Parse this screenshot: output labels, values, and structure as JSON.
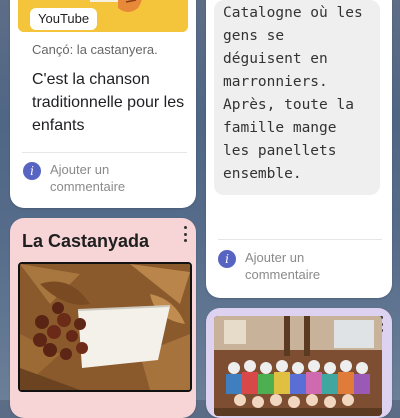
{
  "card1": {
    "thumbnail_badge": "YouTube",
    "caption": "Cançó: la castanyera.",
    "description": "C'est la chanson traditionnelle pour les enfants",
    "comment_label": "Ajouter un commentaire"
  },
  "card2": {
    "text": "Catalogne où les\ngens se\ndéguisent en\nmarronniers.\nAprès, toute la\nfamille mange\nles panellets\nensemble.",
    "comment_label": "Ajouter un commentaire"
  },
  "card3": {
    "title": "La Castanyada"
  },
  "colors": {
    "accent": "#5864c2",
    "card3_bg": "#f7d4d6",
    "card4_bg": "#ddd2f0",
    "thumbnail_bg": "#f4c43b"
  },
  "icons": [
    "info-icon",
    "kebab-menu-icon"
  ]
}
